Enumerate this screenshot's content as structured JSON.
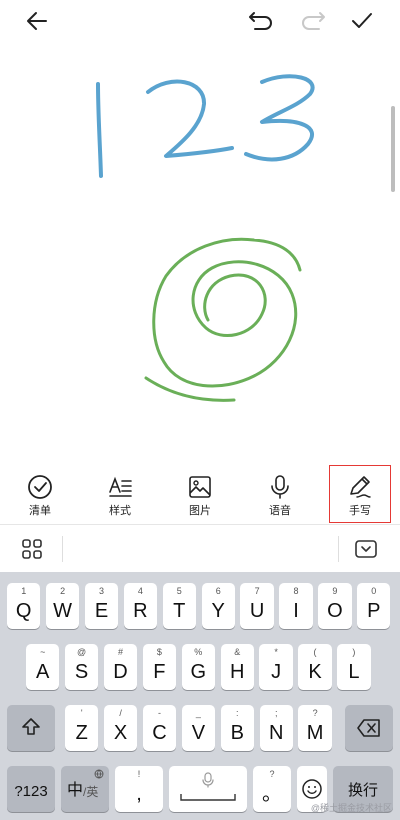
{
  "topbar": {
    "back_icon": "arrow-left-icon",
    "undo_icon": "undo-icon",
    "redo_icon": "redo-icon",
    "confirm_icon": "check-icon"
  },
  "canvas": {
    "number_stroke_color": "#5aa3cf",
    "spiral_stroke_color": "#6aaf58"
  },
  "toolbar": {
    "items": [
      {
        "label": "清单",
        "icon": "checkbox-circle-icon"
      },
      {
        "label": "样式",
        "icon": "text-style-icon"
      },
      {
        "label": "图片",
        "icon": "image-icon"
      },
      {
        "label": "语音",
        "icon": "microphone-icon"
      },
      {
        "label": "手写",
        "icon": "pen-icon",
        "active": true
      }
    ]
  },
  "keyboard": {
    "row1": [
      {
        "main": "Q",
        "sup": "1"
      },
      {
        "main": "W",
        "sup": "2"
      },
      {
        "main": "E",
        "sup": "3"
      },
      {
        "main": "R",
        "sup": "4"
      },
      {
        "main": "T",
        "sup": "5"
      },
      {
        "main": "Y",
        "sup": "6"
      },
      {
        "main": "U",
        "sup": "7"
      },
      {
        "main": "I",
        "sup": "8"
      },
      {
        "main": "O",
        "sup": "9"
      },
      {
        "main": "P",
        "sup": "0"
      }
    ],
    "row2": [
      {
        "main": "A",
        "sup": "~"
      },
      {
        "main": "S",
        "sup": "@"
      },
      {
        "main": "D",
        "sup": "#"
      },
      {
        "main": "F",
        "sup": "$"
      },
      {
        "main": "G",
        "sup": "%"
      },
      {
        "main": "H",
        "sup": "&"
      },
      {
        "main": "J",
        "sup": "*"
      },
      {
        "main": "K",
        "sup": "("
      },
      {
        "main": "L",
        "sup": ")"
      }
    ],
    "row3": [
      {
        "main": "Z",
        "sup": "'"
      },
      {
        "main": "X",
        "sup": "/"
      },
      {
        "main": "C",
        "sup": "-"
      },
      {
        "main": "V",
        "sup": "_"
      },
      {
        "main": "B",
        "sup": ":"
      },
      {
        "main": "N",
        "sup": ";"
      },
      {
        "main": "M",
        "sup": "?"
      }
    ],
    "num_switch": "?123",
    "lang_main": "中",
    "lang_sub": "/英",
    "comma": ",",
    "comma_sup": "!",
    "period": "。",
    "period_sup": "?",
    "enter": "换行",
    "watermark": "@稀土掘金技术社区"
  }
}
